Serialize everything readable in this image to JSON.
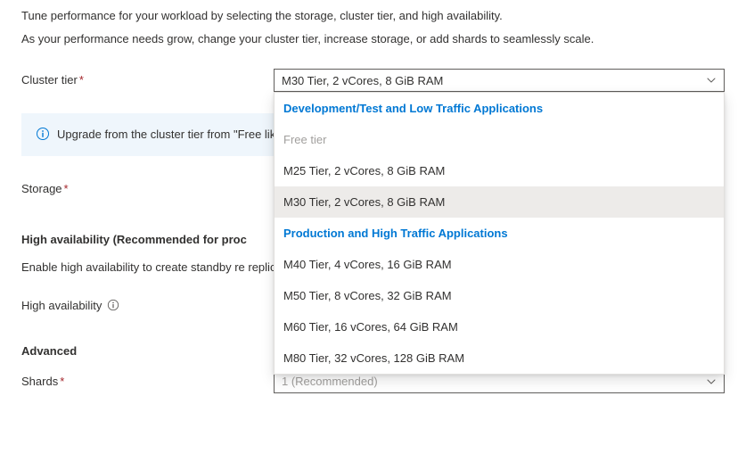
{
  "intro": {
    "line1": "Tune performance for your workload by selecting the storage, cluster tier, and high availability.",
    "line2": "As your performance needs grow, change your cluster tier, increase storage, or add shards to seamlessly scale."
  },
  "clusterTier": {
    "label": "Cluster tier",
    "selected": "M30 Tier, 2 vCores, 8 GiB RAM",
    "dropdown": {
      "group1Header": "Development/Test and Low Traffic Applications",
      "group1": [
        {
          "label": "Free tier",
          "disabled": true
        },
        {
          "label": "M25 Tier, 2 vCores, 8 GiB RAM",
          "disabled": false
        },
        {
          "label": "M30 Tier, 2 vCores, 8 GiB RAM",
          "disabled": false,
          "selected": true
        }
      ],
      "group2Header": "Production and High Traffic Applications",
      "group2": [
        {
          "label": "M40 Tier, 4 vCores, 16 GiB RAM"
        },
        {
          "label": "M50 Tier, 8 vCores, 32 GiB RAM"
        },
        {
          "label": "M60 Tier, 16 vCores, 64 GiB RAM"
        },
        {
          "label": "M80 Tier, 32 vCores, 128 GiB RAM"
        }
      ]
    }
  },
  "infoBanner": {
    "text": "Upgrade from the cluster tier from \"Free like \"Storage\" or \"High availability\"."
  },
  "storage": {
    "label": "Storage"
  },
  "highAvailabilitySection": {
    "heading": "High availability (Recommended for proc",
    "description": "Enable high availability to create standby re replicas.",
    "label": "High availability"
  },
  "advanced": {
    "heading": "Advanced"
  },
  "shards": {
    "label": "Shards",
    "selected": "1 (Recommended)"
  }
}
